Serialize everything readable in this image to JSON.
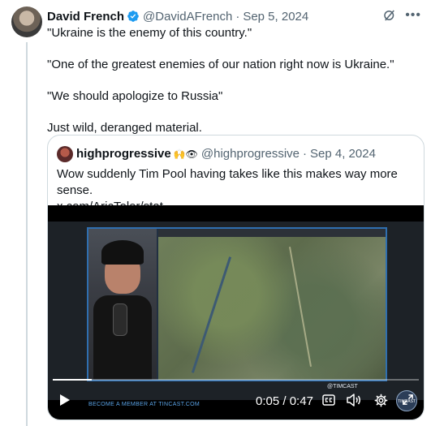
{
  "tweet": {
    "author_name": "David French",
    "author_handle": "@DavidAFrench",
    "separator": "·",
    "date": "Sep 5, 2024",
    "lines": [
      "\"Ukraine is the enemy of this country.\"",
      "\"One of the greatest enemies of our nation right now is Ukraine.\"",
      "\"We should apologize to Russia\"",
      "Just wild, deranged material."
    ]
  },
  "quote": {
    "author_name": "highprogressive",
    "emoji": "🙌👁",
    "author_handle": "@highprogressive",
    "separator": "·",
    "date": "Sep 4, 2024",
    "text_line1": "Wow suddenly Tim Pool having takes like this makes way more sense.",
    "text_line2": "x.com/AricToler/stat..."
  },
  "video": {
    "current_time": "0:05",
    "duration": "0:47",
    "time_separator": " / ",
    "progress_fraction": 0.106,
    "member_banner": "BECOME A MEMBER AT TINCAST.COM",
    "watermark": "@TIMCAST",
    "logo_text": "TIMCAST"
  },
  "icons": {
    "verified": "verified-badge-icon",
    "grok": "grok-icon",
    "more": "more-icon",
    "play": "play-icon",
    "cc": "closed-captions-icon",
    "volume": "volume-icon",
    "settings": "settings-icon",
    "expand": "fullscreen-icon"
  },
  "colors": {
    "accent": "#1d9bf0",
    "text": "#0f1419",
    "secondary": "#536471",
    "border": "#cfd9de"
  }
}
